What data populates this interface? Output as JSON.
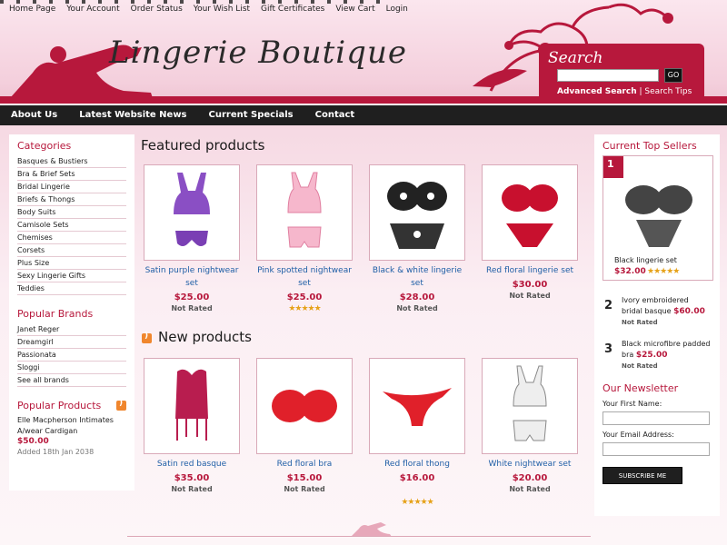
{
  "topnav": [
    "Home Page",
    "Your Account",
    "Order Status",
    "Your Wish List",
    "Gift Certificates",
    "View Cart",
    "Login"
  ],
  "logo": "Lingerie Boutique",
  "search": {
    "title": "Search",
    "go": "GO",
    "advanced": "Advanced Search",
    "sep": " | ",
    "tips": "Search Tips"
  },
  "mainnav": [
    "About Us",
    "Latest Website News",
    "Current Specials",
    "Contact"
  ],
  "categories": {
    "title": "Categories",
    "items": [
      "Basques & Bustiers",
      "Bra & Brief Sets",
      "Bridal Lingerie",
      "Briefs & Thongs",
      "Body Suits",
      "Camisole Sets",
      "Chemises",
      "Corsets",
      "Plus Size",
      "Sexy Lingerie Gifts",
      "Teddies"
    ]
  },
  "brands": {
    "title": "Popular Brands",
    "items": [
      "Janet Reger",
      "Dreamgirl",
      "Passionata",
      "Sloggi",
      "See all brands"
    ]
  },
  "popular": {
    "title": "Popular Products",
    "name": "Elle Macpherson Intimates A/wear Cardigan",
    "price": "$50.00",
    "added": "Added 18th Jan 2038"
  },
  "featured": {
    "title": "Featured products",
    "items": [
      {
        "name": "Satin purple nightwear set",
        "price": "$25.00",
        "rating": "Not Rated"
      },
      {
        "name": "Pink spotted nightwear set",
        "price": "$25.00",
        "rating": "★★★★★"
      },
      {
        "name": "Black & white lingerie set",
        "price": "$28.00",
        "rating": "Not Rated"
      },
      {
        "name": "Red floral lingerie set",
        "price": "$30.00",
        "rating": "Not Rated"
      }
    ]
  },
  "newprod": {
    "title": "New products",
    "items": [
      {
        "name": "Satin red basque",
        "price": "$35.00",
        "rating": "Not Rated"
      },
      {
        "name": "Red floral bra",
        "price": "$15.00",
        "rating": "Not Rated"
      },
      {
        "name": "Red floral thong",
        "price": "$16.00",
        "rating": "★★★★★"
      },
      {
        "name": "White nightwear set",
        "price": "$20.00",
        "rating": "Not Rated"
      }
    ]
  },
  "topsellers": {
    "title": "Current Top Sellers",
    "first": {
      "rank": "1",
      "name": "Black lingerie set",
      "price": "$32.00",
      "stars": "★★★★★"
    },
    "others": [
      {
        "rank": "2",
        "name": "Ivory embroidered bridal basque",
        "price": "$60.00",
        "rating": "Not Rated"
      },
      {
        "rank": "3",
        "name": "Black microfibre padded bra",
        "price": "$25.00",
        "rating": "Not Rated"
      }
    ]
  },
  "newsletter": {
    "title": "Our Newsletter",
    "first_name": "Your First Name:",
    "email": "Your Email Address:",
    "button": "SUBSCRIBE ME"
  },
  "colors": {
    "accent": "#b7183c",
    "nav": "#1f1f1f",
    "link": "#1f5fa6"
  }
}
